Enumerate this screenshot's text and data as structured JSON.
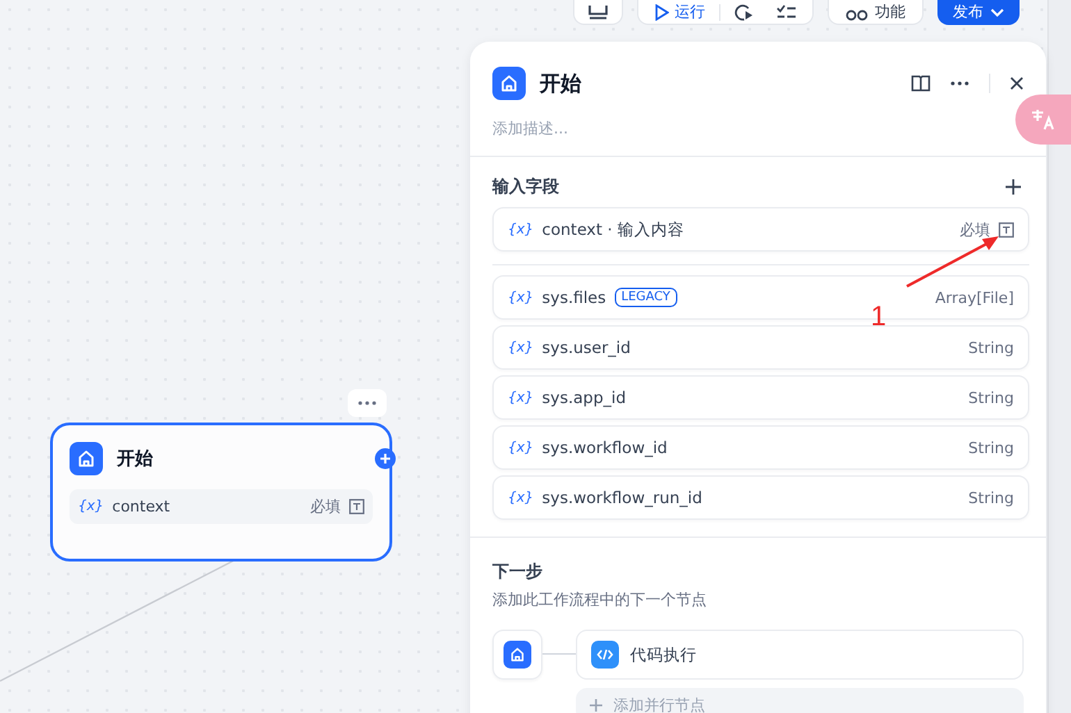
{
  "toolbar": {
    "run_label": "运行",
    "features_label": "功能",
    "publish_label": "发布"
  },
  "canvas_node": {
    "title": "开始",
    "variables": [
      {
        "icon_text": "{x}",
        "name": "context",
        "required": "必填"
      }
    ]
  },
  "panel": {
    "title": "开始",
    "description_placeholder": "添加描述...",
    "inputs": {
      "title": "输入字段",
      "fields": [
        {
          "icon_text": "{x}",
          "name": "context · 输入内容",
          "required": "必填"
        }
      ]
    },
    "system_variables": [
      {
        "icon_text": "{x}",
        "name": "sys.files",
        "badge": "LEGACY",
        "type": "Array[File]"
      },
      {
        "icon_text": "{x}",
        "name": "sys.user_id",
        "type": "String"
      },
      {
        "icon_text": "{x}",
        "name": "sys.app_id",
        "type": "String"
      },
      {
        "icon_text": "{x}",
        "name": "sys.workflow_id",
        "type": "String"
      },
      {
        "icon_text": "{x}",
        "name": "sys.workflow_run_id",
        "type": "String"
      }
    ],
    "next_step": {
      "title": "下一步",
      "description": "添加此工作流程中的下一个节点",
      "nodes": [
        {
          "title": "代码执行"
        }
      ],
      "add_parallel": "添加并行节点"
    }
  },
  "annotation": {
    "label": "1"
  }
}
